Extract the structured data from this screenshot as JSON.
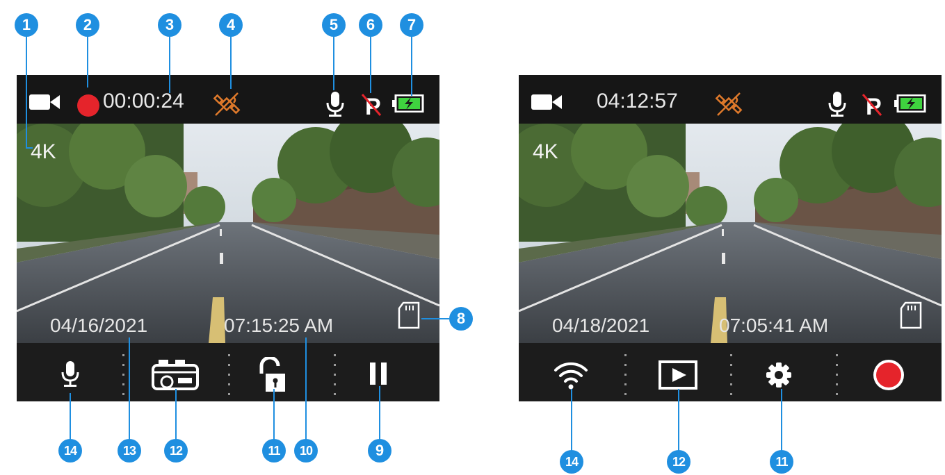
{
  "left_screen": {
    "record_timer": "00:00:24",
    "resolution": "4K",
    "date": "04/16/2021",
    "time": "07:15:25  AM",
    "bottom_buttons": [
      "microphone",
      "camera",
      "unlock",
      "pause"
    ]
  },
  "right_screen": {
    "record_timer": "04:12:57",
    "resolution": "4K",
    "date": "04/18/2021",
    "time": "07:05:41  AM",
    "bottom_buttons": [
      "wifi",
      "playback",
      "settings",
      "record"
    ]
  },
  "callouts": {
    "top": [
      "1",
      "2",
      "3",
      "4",
      "5",
      "6",
      "7"
    ],
    "side": [
      "8"
    ],
    "bottom_left": [
      "14",
      "13",
      "12",
      "11",
      "10",
      "9"
    ],
    "bottom_right": [
      "14",
      "12",
      "11"
    ]
  },
  "colors": {
    "callout": "#1f8fe0",
    "record": "#e5242b",
    "gps": "#e07a2b",
    "battery": "#3fd23f",
    "screen_bg": "#161616"
  },
  "icons": {
    "video": "video-camera-icon",
    "record_dot": "record-dot-icon",
    "gps": "gps-satellite-icon",
    "mic": "microphone-icon",
    "parking": "parking-off-icon",
    "battery": "battery-charging-icon",
    "sd_card": "sd-card-icon"
  }
}
